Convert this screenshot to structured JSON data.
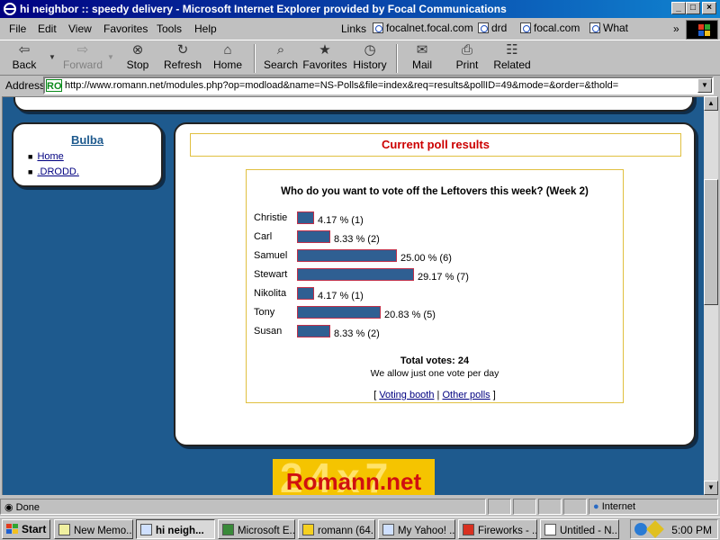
{
  "window": {
    "title": "hi neighbor :: speedy delivery - Microsoft Internet Explorer provided by Focal Communications",
    "min_glyph": "_",
    "max_glyph": "□",
    "close_glyph": "×"
  },
  "menubar": {
    "items": [
      "File",
      "Edit",
      "View",
      "Favorites",
      "Tools",
      "Help"
    ],
    "links_label": "Links",
    "links": [
      "focalnet.focal.com",
      "drd",
      "focal.com",
      "What"
    ],
    "chevron": "»"
  },
  "toolbar": {
    "buttons": [
      {
        "label": "Back",
        "icon": "⇦"
      },
      {
        "label": "Forward",
        "icon": "⇨"
      },
      {
        "label": "Stop",
        "icon": "⊗"
      },
      {
        "label": "Refresh",
        "icon": "↻"
      },
      {
        "label": "Home",
        "icon": "⌂"
      },
      {
        "label": "Search",
        "icon": "⌕"
      },
      {
        "label": "Favorites",
        "icon": "★"
      },
      {
        "label": "History",
        "icon": "◷"
      },
      {
        "label": "Mail",
        "icon": "✉"
      },
      {
        "label": "Print",
        "icon": "⎙"
      },
      {
        "label": "Related",
        "icon": "☷"
      }
    ]
  },
  "address": {
    "label": "Address",
    "icon_text": "RO",
    "url": "http://www.romann.net/modules.php?op=modload&name=NS-Polls&file=index&req=results&pollID=49&mode=&order=&thold="
  },
  "sidebar_block": {
    "title": "Bulba",
    "items": [
      "Home",
      ".DRODD."
    ]
  },
  "poll": {
    "header": "Current poll results",
    "question": "Who do you want to vote off the Leftovers this week? (Week 2)",
    "options": [
      {
        "name": "Christie",
        "percent": 4.17,
        "percent_text": "4.17 % (1)",
        "votes": 1
      },
      {
        "name": "Carl",
        "percent": 8.33,
        "percent_text": "8.33 % (2)",
        "votes": 2
      },
      {
        "name": "Samuel",
        "percent": 25.0,
        "percent_text": "25.00 % (6)",
        "votes": 6
      },
      {
        "name": "Stewart",
        "percent": 29.17,
        "percent_text": "29.17 % (7)",
        "votes": 7
      },
      {
        "name": "Nikolita",
        "percent": 4.17,
        "percent_text": "4.17 % (1)",
        "votes": 1
      },
      {
        "name": "Tony",
        "percent": 20.83,
        "percent_text": "20.83 % (5)",
        "votes": 5
      },
      {
        "name": "Susan",
        "percent": 8.33,
        "percent_text": "8.33 % (2)",
        "votes": 2
      }
    ],
    "total_votes": "Total votes: 24",
    "note": "We allow just one vote per day",
    "bracket_open": "[",
    "separator": "|",
    "bracket_close": "]",
    "links": [
      "Voting booth",
      "Other polls"
    ]
  },
  "banner": {
    "bg_text": "24x7",
    "text": "Romann.net"
  },
  "statusbar": {
    "status": "Done",
    "zone": "Internet"
  },
  "taskbar": {
    "start": "Start",
    "tasks": [
      "New Memo...",
      "hi neigh...",
      "Microsoft E...",
      "romann (64...",
      "My Yahoo! ...",
      "Fireworks - ...",
      "Untitled - N..."
    ],
    "clock": "5:00 PM"
  }
}
